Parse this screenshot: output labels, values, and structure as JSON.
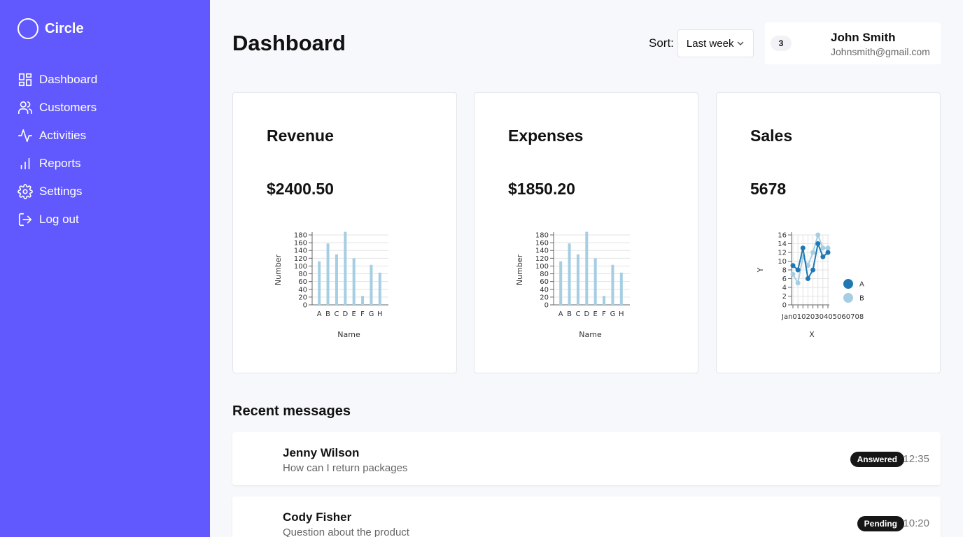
{
  "brand": {
    "name": "Circle"
  },
  "nav": [
    {
      "label": "Dashboard",
      "icon": "grid-icon"
    },
    {
      "label": "Customers",
      "icon": "users-icon"
    },
    {
      "label": "Activities",
      "icon": "activity-icon"
    },
    {
      "label": "Reports",
      "icon": "bar-chart-icon"
    },
    {
      "label": "Settings",
      "icon": "gear-icon"
    },
    {
      "label": "Log out",
      "icon": "logout-icon"
    }
  ],
  "header": {
    "title": "Dashboard",
    "sort_label": "Sort:",
    "sort_value": "Last week",
    "notification_count": "3",
    "user_name": "John Smith",
    "user_email": "Johnsmith@gmail.com"
  },
  "cards": [
    {
      "title": "Revenue",
      "value": "$2400.50"
    },
    {
      "title": "Expenses",
      "value": "$1850.20"
    },
    {
      "title": "Sales",
      "value": "5678"
    }
  ],
  "chart_data": [
    {
      "type": "bar",
      "categories": [
        "A",
        "B",
        "C",
        "D",
        "E",
        "F",
        "G",
        "H"
      ],
      "values": [
        112,
        158,
        130,
        188,
        120,
        23,
        103,
        83
      ],
      "xlabel": "Name",
      "ylabel": "Number",
      "ylim": [
        0,
        180
      ],
      "yticks": [
        0,
        20,
        40,
        60,
        80,
        100,
        120,
        140,
        160,
        180
      ],
      "grid": true,
      "color": "#a6cee3"
    },
    {
      "type": "bar",
      "categories": [
        "A",
        "B",
        "C",
        "D",
        "E",
        "F",
        "G",
        "H"
      ],
      "values": [
        112,
        158,
        130,
        188,
        120,
        23,
        103,
        83
      ],
      "xlabel": "Name",
      "ylabel": "Number",
      "ylim": [
        0,
        180
      ],
      "yticks": [
        0,
        20,
        40,
        60,
        80,
        100,
        120,
        140,
        160,
        180
      ],
      "grid": true,
      "color": "#a6cee3"
    },
    {
      "type": "line",
      "x": [
        "Jan01",
        "Jan02",
        "Jan03",
        "Jan04",
        "Jan05",
        "Jan06",
        "Jan07",
        "Jan08"
      ],
      "xtick_text": "Jan0102030405060708",
      "series": [
        {
          "name": "A",
          "values": [
            9,
            8,
            13,
            6,
            8,
            14,
            11,
            12
          ],
          "color": "#1f78b4"
        },
        {
          "name": "B",
          "values": [
            7,
            5,
            11,
            9,
            12,
            16,
            13,
            13
          ],
          "color": "#a6cee3"
        }
      ],
      "xlabel": "X",
      "ylabel": "Y",
      "ylim": [
        0,
        16
      ],
      "yticks": [
        0,
        2,
        4,
        6,
        8,
        10,
        12,
        14,
        16
      ],
      "grid": true,
      "legend": "right"
    }
  ],
  "messages_title": "Recent messages",
  "messages": [
    {
      "name": "Jenny Wilson",
      "text": "How can I return packages",
      "status": "Answered",
      "time": "12:35"
    },
    {
      "name": "Cody Fisher",
      "text": "Question about the product",
      "status": "Pending",
      "time": "10:20"
    }
  ]
}
